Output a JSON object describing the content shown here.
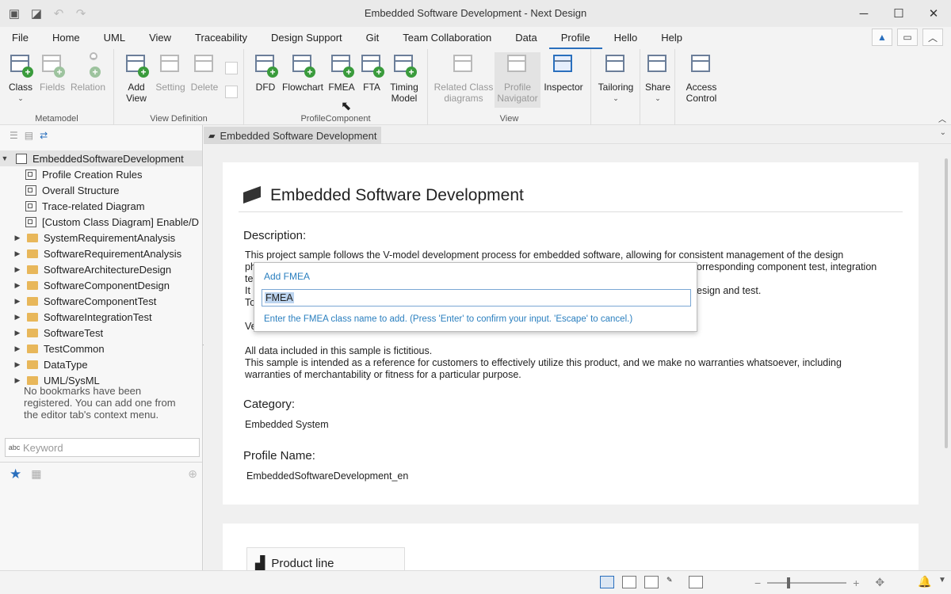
{
  "window": {
    "title": "Embedded Software Development - Next Design"
  },
  "menu": [
    "File",
    "Home",
    "UML",
    "View",
    "Traceability",
    "Design Support",
    "Git",
    "Team Collaboration",
    "Data",
    "Profile",
    "Hello",
    "Help"
  ],
  "ribbon": {
    "metamodel": {
      "label": "Metamodel",
      "class": "Class",
      "fields": "Fields",
      "relation": "Relation"
    },
    "viewdef": {
      "label": "View Definition",
      "add_view": "Add View",
      "setting": "Setting",
      "delete": "Delete"
    },
    "profilecomp": {
      "label": "ProfileComponent",
      "dfd": "DFD",
      "flowchart": "Flowchart",
      "fmea": "FMEA",
      "fta": "FTA",
      "timing": "Timing Model"
    },
    "view": {
      "label": "View",
      "related": "Related Class diagrams",
      "navigator": "Profile Navigator",
      "inspector": "Inspector"
    },
    "tailoring": "Tailoring",
    "share": "Share",
    "access": "Access Control"
  },
  "tree": {
    "root": "EmbeddedSoftwareDevelopment",
    "diagrams": [
      "Profile Creation Rules",
      "Overall Structure",
      "Trace-related Diagram",
      "[Custom Class Diagram] Enable/D"
    ],
    "folders": [
      "SystemRequirementAnalysis",
      "SoftwareRequirementAnalysis",
      "SoftwareArchitectureDesign",
      "SoftwareComponentDesign",
      "SoftwareComponentTest",
      "SoftwareIntegrationTest",
      "SoftwareTest",
      "TestCommon",
      "DataType",
      "UML/SysML"
    ]
  },
  "search": {
    "placeholder": "Keyword"
  },
  "bookmarks": {
    "empty": "No bookmarks have been registered. You can add one from the editor tab's context menu."
  },
  "tab": {
    "label": "Embedded Software Development"
  },
  "doc": {
    "title": "Embedded Software Development",
    "description_label": "Description:",
    "desc_line1": "This project sample follows the V-model development process for embedded software, allowing for consistent management of the design",
    "desc_line2a": "ph",
    "desc_line2b": "orresponding component test, integration",
    "desc_line3": "te",
    "desc_line4a": "It",
    "desc_line4b": "esign and test.",
    "desc_line5": "To",
    "ve": "Ve",
    "fict1": "All data included in this sample is fictitious.",
    "fict2": "This sample is intended as a reference for customers to effectively utilize this product, and we make no warranties whatsoever, including",
    "fict3": "warranties of merchantability or fitness for a particular purpose.",
    "category_label": "Category:",
    "category": "Embedded System",
    "profile_label": "Profile Name:",
    "profile": "EmbeddedSoftwareDevelopment_en",
    "product_line": "Product line"
  },
  "popup": {
    "title": "Add FMEA",
    "value": "FMEA",
    "hint": "Enter the FMEA class name to add. (Press 'Enter' to confirm your input. 'Escape' to cancel.)"
  },
  "colors": {
    "accent": "#2a6fbd",
    "hint": "#2a7fbf",
    "folder": "#e8b75a",
    "plus": "#3a9b3c"
  }
}
